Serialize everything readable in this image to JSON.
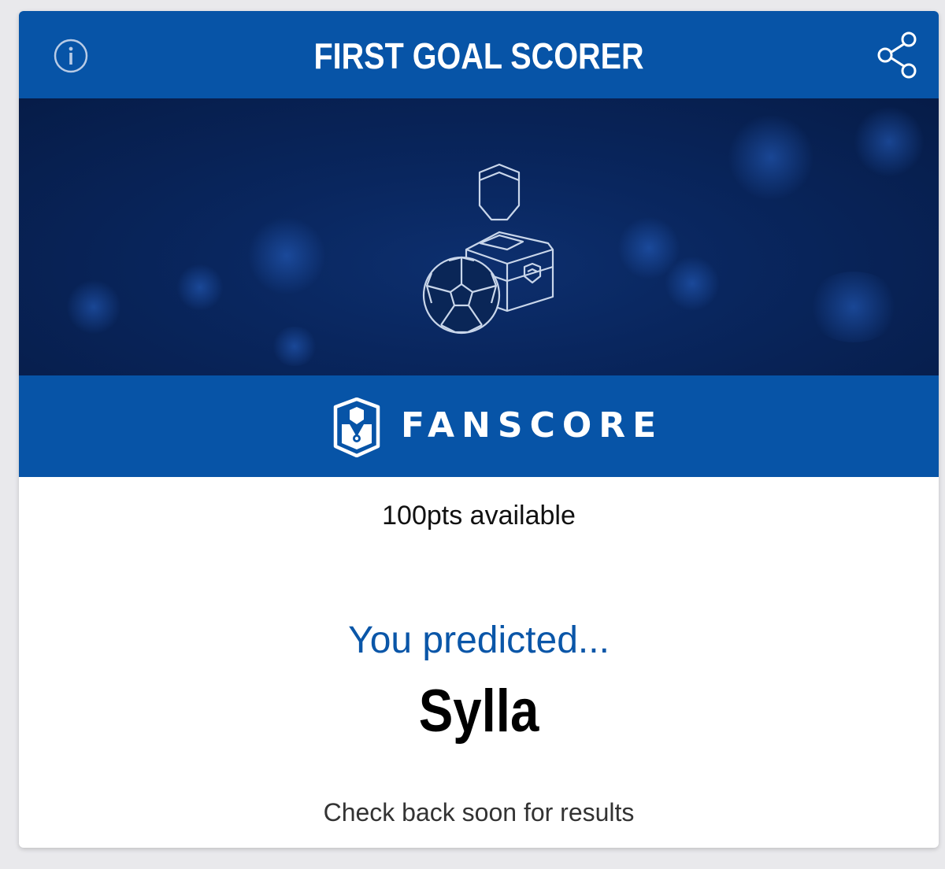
{
  "header": {
    "title": "FIRST GOAL SCORER",
    "info_icon": "info-icon",
    "share_icon": "share-icon"
  },
  "hero": {
    "illustration": "player-with-football-icon"
  },
  "brand": {
    "logo": "fanscore-logo",
    "name": "FANSCORE"
  },
  "content": {
    "points": "100pts available",
    "predicted_label": "You predicted...",
    "predicted_value": "Sylla",
    "footer_note": "Check back soon for results"
  },
  "colors": {
    "brand_blue": "#0754a7",
    "hero_dark": "#061c48",
    "accent_text": "#0a56a8"
  }
}
